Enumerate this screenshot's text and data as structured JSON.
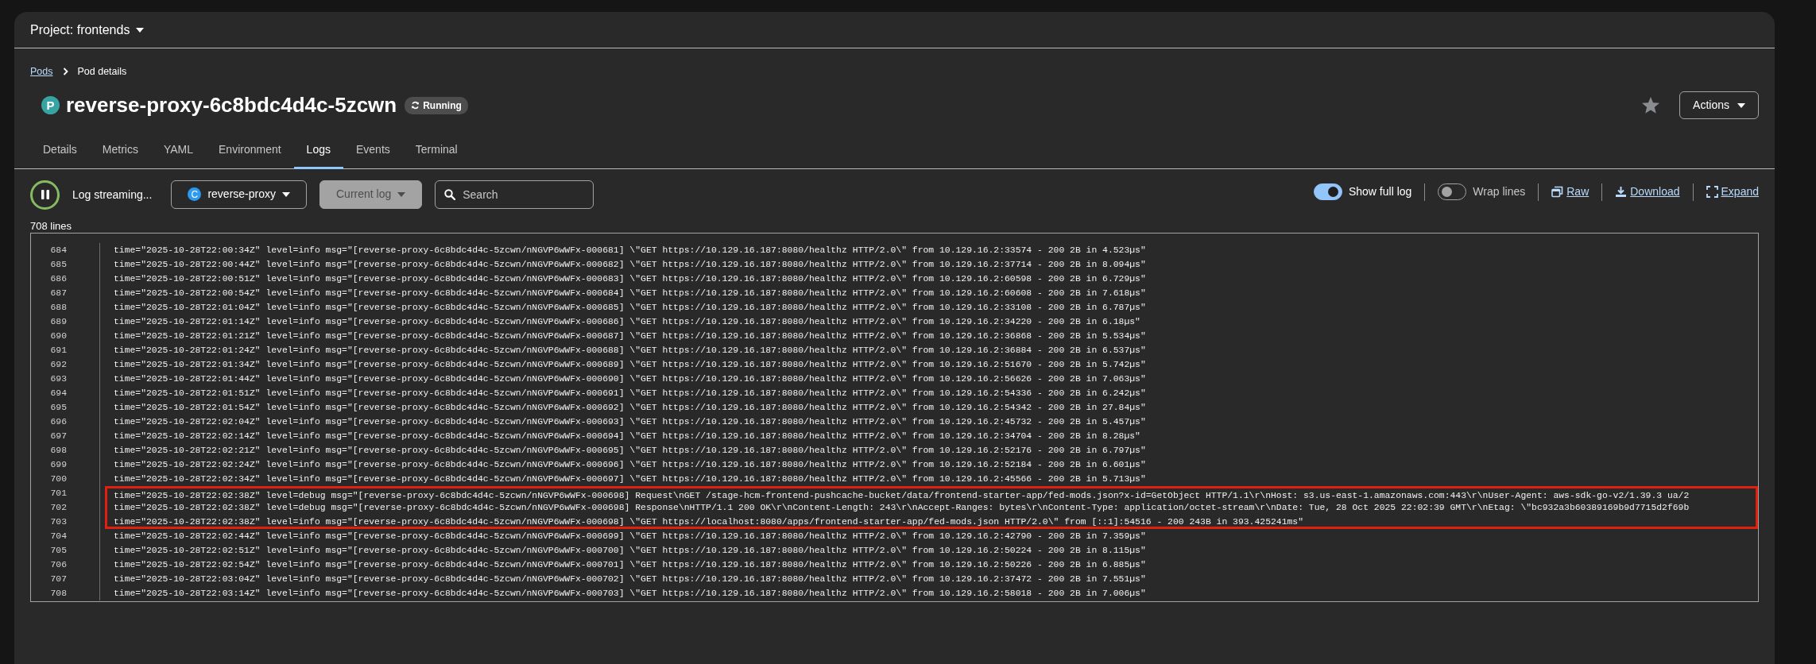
{
  "project_selector": {
    "label": "Project: frontends"
  },
  "breadcrumb": [
    {
      "label": "Pods",
      "link": true
    },
    {
      "label": "Pod details",
      "link": false
    }
  ],
  "resource": {
    "badge": "P",
    "name": "reverse-proxy-6c8bdc4d4c-5zcwn",
    "status": "Running"
  },
  "favorite": {
    "starred": false
  },
  "actions_button": {
    "label": "Actions"
  },
  "tabs": [
    {
      "label": "Details",
      "selected": false
    },
    {
      "label": "Metrics",
      "selected": false
    },
    {
      "label": "YAML",
      "selected": false
    },
    {
      "label": "Environment",
      "selected": false
    },
    {
      "label": "Logs",
      "selected": true
    },
    {
      "label": "Events",
      "selected": false
    },
    {
      "label": "Terminal",
      "selected": false
    }
  ],
  "toolbar": {
    "streaming_label": "Log streaming...",
    "container": {
      "badge": "C",
      "label": "reverse-proxy"
    },
    "log_select": {
      "label": "Current log",
      "disabled": true
    },
    "search": {
      "placeholder": "Search"
    },
    "toggles": [
      {
        "label": "Show full log",
        "on": true
      },
      {
        "label": "Wrap lines",
        "on": false
      }
    ],
    "links": [
      {
        "kind": "raw",
        "label": "Raw"
      },
      {
        "kind": "download",
        "label": "Download"
      },
      {
        "kind": "expand",
        "label": "Expand"
      }
    ]
  },
  "line_count": "708 lines",
  "log_lines": [
    {
      "number": "684",
      "text": "time=\"2025-10-28T22:00:34Z\" level=info msg=\"[reverse-proxy-6c8bdc4d4c-5zcwn/nNGVP6wWFx-000681] \\\"GET https://10.129.16.187:8080/healthz HTTP/2.0\\\" from 10.129.16.2:33574 - 200 2B in 4.523µs\"",
      "highlighted": false
    },
    {
      "number": "685",
      "text": "time=\"2025-10-28T22:00:44Z\" level=info msg=\"[reverse-proxy-6c8bdc4d4c-5zcwn/nNGVP6wWFx-000682] \\\"GET https://10.129.16.187:8080/healthz HTTP/2.0\\\" from 10.129.16.2:37714 - 200 2B in 8.094µs\"",
      "highlighted": false
    },
    {
      "number": "686",
      "text": "time=\"2025-10-28T22:00:51Z\" level=info msg=\"[reverse-proxy-6c8bdc4d4c-5zcwn/nNGVP6wWFx-000683] \\\"GET https://10.129.16.187:8080/healthz HTTP/2.0\\\" from 10.129.16.2:60598 - 200 2B in 6.729µs\"",
      "highlighted": false
    },
    {
      "number": "687",
      "text": "time=\"2025-10-28T22:00:54Z\" level=info msg=\"[reverse-proxy-6c8bdc4d4c-5zcwn/nNGVP6wWFx-000684] \\\"GET https://10.129.16.187:8080/healthz HTTP/2.0\\\" from 10.129.16.2:60608 - 200 2B in 7.618µs\"",
      "highlighted": false
    },
    {
      "number": "688",
      "text": "time=\"2025-10-28T22:01:04Z\" level=info msg=\"[reverse-proxy-6c8bdc4d4c-5zcwn/nNGVP6wWFx-000685] \\\"GET https://10.129.16.187:8080/healthz HTTP/2.0\\\" from 10.129.16.2:33108 - 200 2B in 6.787µs\"",
      "highlighted": false
    },
    {
      "number": "689",
      "text": "time=\"2025-10-28T22:01:14Z\" level=info msg=\"[reverse-proxy-6c8bdc4d4c-5zcwn/nNGVP6wWFx-000686] \\\"GET https://10.129.16.187:8080/healthz HTTP/2.0\\\" from 10.129.16.2:34220 - 200 2B in 6.18µs\"",
      "highlighted": false
    },
    {
      "number": "690",
      "text": "time=\"2025-10-28T22:01:21Z\" level=info msg=\"[reverse-proxy-6c8bdc4d4c-5zcwn/nNGVP6wWFx-000687] \\\"GET https://10.129.16.187:8080/healthz HTTP/2.0\\\" from 10.129.16.2:36868 - 200 2B in 5.534µs\"",
      "highlighted": false
    },
    {
      "number": "691",
      "text": "time=\"2025-10-28T22:01:24Z\" level=info msg=\"[reverse-proxy-6c8bdc4d4c-5zcwn/nNGVP6wWFx-000688] \\\"GET https://10.129.16.187:8080/healthz HTTP/2.0\\\" from 10.129.16.2:36884 - 200 2B in 6.537µs\"",
      "highlighted": false
    },
    {
      "number": "692",
      "text": "time=\"2025-10-28T22:01:34Z\" level=info msg=\"[reverse-proxy-6c8bdc4d4c-5zcwn/nNGVP6wWFx-000689] \\\"GET https://10.129.16.187:8080/healthz HTTP/2.0\\\" from 10.129.16.2:51670 - 200 2B in 5.742µs\"",
      "highlighted": false
    },
    {
      "number": "693",
      "text": "time=\"2025-10-28T22:01:44Z\" level=info msg=\"[reverse-proxy-6c8bdc4d4c-5zcwn/nNGVP6wWFx-000690] \\\"GET https://10.129.16.187:8080/healthz HTTP/2.0\\\" from 10.129.16.2:56626 - 200 2B in 7.063µs\"",
      "highlighted": false
    },
    {
      "number": "694",
      "text": "time=\"2025-10-28T22:01:51Z\" level=info msg=\"[reverse-proxy-6c8bdc4d4c-5zcwn/nNGVP6wWFx-000691] \\\"GET https://10.129.16.187:8080/healthz HTTP/2.0\\\" from 10.129.16.2:54336 - 200 2B in 6.242µs\"",
      "highlighted": false
    },
    {
      "number": "695",
      "text": "time=\"2025-10-28T22:01:54Z\" level=info msg=\"[reverse-proxy-6c8bdc4d4c-5zcwn/nNGVP6wWFx-000692] \\\"GET https://10.129.16.187:8080/healthz HTTP/2.0\\\" from 10.129.16.2:54342 - 200 2B in 27.84µs\"",
      "highlighted": false
    },
    {
      "number": "696",
      "text": "time=\"2025-10-28T22:02:04Z\" level=info msg=\"[reverse-proxy-6c8bdc4d4c-5zcwn/nNGVP6wWFx-000693] \\\"GET https://10.129.16.187:8080/healthz HTTP/2.0\\\" from 10.129.16.2:45732 - 200 2B in 5.457µs\"",
      "highlighted": false
    },
    {
      "number": "697",
      "text": "time=\"2025-10-28T22:02:14Z\" level=info msg=\"[reverse-proxy-6c8bdc4d4c-5zcwn/nNGVP6wWFx-000694] \\\"GET https://10.129.16.187:8080/healthz HTTP/2.0\\\" from 10.129.16.2:34704 - 200 2B in 8.28µs\"",
      "highlighted": false
    },
    {
      "number": "698",
      "text": "time=\"2025-10-28T22:02:21Z\" level=info msg=\"[reverse-proxy-6c8bdc4d4c-5zcwn/nNGVP6wWFx-000695] \\\"GET https://10.129.16.187:8080/healthz HTTP/2.0\\\" from 10.129.16.2:52176 - 200 2B in 6.797µs\"",
      "highlighted": false
    },
    {
      "number": "699",
      "text": "time=\"2025-10-28T22:02:24Z\" level=info msg=\"[reverse-proxy-6c8bdc4d4c-5zcwn/nNGVP6wWFx-000696] \\\"GET https://10.129.16.187:8080/healthz HTTP/2.0\\\" from 10.129.16.2:52184 - 200 2B in 6.601µs\"",
      "highlighted": false
    },
    {
      "number": "700",
      "text": "time=\"2025-10-28T22:02:34Z\" level=info msg=\"[reverse-proxy-6c8bdc4d4c-5zcwn/nNGVP6wWFx-000697] \\\"GET https://10.129.16.187:8080/healthz HTTP/2.0\\\" from 10.129.16.2:45566 - 200 2B in 5.713µs\"",
      "highlighted": false
    },
    {
      "number": "701",
      "text": "time=\"2025-10-28T22:02:38Z\" level=debug msg=\"[reverse-proxy-6c8bdc4d4c-5zcwn/nNGVP6wWFx-000698] Request\\nGET /stage-hcm-frontend-pushcache-bucket/data/frontend-starter-app/fed-mods.json?x-id=GetObject HTTP/1.1\\r\\nHost: s3.us-east-1.amazonaws.com:443\\r\\nUser-Agent: aws-sdk-go-v2/1.39.3 ua/2",
      "highlighted": true
    },
    {
      "number": "702",
      "text": "time=\"2025-10-28T22:02:38Z\" level=debug msg=\"[reverse-proxy-6c8bdc4d4c-5zcwn/nNGVP6wWFx-000698] Response\\nHTTP/1.1 200 OK\\r\\nContent-Length: 243\\r\\nAccept-Ranges: bytes\\r\\nContent-Type: application/octet-stream\\r\\nDate: Tue, 28 Oct 2025 22:02:39 GMT\\r\\nEtag: \\\"bc932a3b60389169b9d7715d2f69b",
      "highlighted": true
    },
    {
      "number": "703",
      "text": "time=\"2025-10-28T22:02:38Z\" level=info msg=\"[reverse-proxy-6c8bdc4d4c-5zcwn/nNGVP6wWFx-000698] \\\"GET https://localhost:8080/apps/frontend-starter-app/fed-mods.json HTTP/2.0\\\" from [::1]:54516 - 200 243B in 393.425241ms\"",
      "highlighted": true
    },
    {
      "number": "704",
      "text": "time=\"2025-10-28T22:02:44Z\" level=info msg=\"[reverse-proxy-6c8bdc4d4c-5zcwn/nNGVP6wWFx-000699] \\\"GET https://10.129.16.187:8080/healthz HTTP/2.0\\\" from 10.129.16.2:42790 - 200 2B in 7.359µs\"",
      "highlighted": false
    },
    {
      "number": "705",
      "text": "time=\"2025-10-28T22:02:51Z\" level=info msg=\"[reverse-proxy-6c8bdc4d4c-5zcwn/nNGVP6wWFx-000700] \\\"GET https://10.129.16.187:8080/healthz HTTP/2.0\\\" from 10.129.16.2:50224 - 200 2B in 8.115µs\"",
      "highlighted": false
    },
    {
      "number": "706",
      "text": "time=\"2025-10-28T22:02:54Z\" level=info msg=\"[reverse-proxy-6c8bdc4d4c-5zcwn/nNGVP6wWFx-000701] \\\"GET https://10.129.16.187:8080/healthz HTTP/2.0\\\" from 10.129.16.2:50226 - 200 2B in 6.885µs\"",
      "highlighted": false
    },
    {
      "number": "707",
      "text": "time=\"2025-10-28T22:03:04Z\" level=info msg=\"[reverse-proxy-6c8bdc4d4c-5zcwn/nNGVP6wWFx-000702] \\\"GET https://10.129.16.187:8080/healthz HTTP/2.0\\\" from 10.129.16.2:37472 - 200 2B in 7.551µs\"",
      "highlighted": false
    },
    {
      "number": "708",
      "text": "time=\"2025-10-28T22:03:14Z\" level=info msg=\"[reverse-proxy-6c8bdc4d4c-5zcwn/nNGVP6wWFx-000703] \\\"GET https://10.129.16.187:8080/healthz HTTP/2.0\\\" from 10.129.16.2:58018 - 200 2B in 7.006µs\"",
      "highlighted": false
    }
  ]
}
